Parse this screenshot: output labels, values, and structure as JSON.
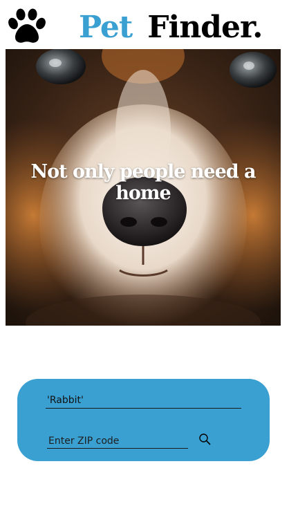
{
  "header": {
    "logo_icon": "paw-icon",
    "brand_first": "Pet",
    "brand_second": "Finder.",
    "brand_accent_color": "#3a9fd1"
  },
  "hero": {
    "image_subject": "puppy close-up",
    "tagline": "Not only people need a home"
  },
  "search": {
    "card_color": "#3a9fd1",
    "pet_value": "'Rabbit'",
    "zip_placeholder": "Enter ZIP code",
    "button_icon": "search-icon"
  }
}
